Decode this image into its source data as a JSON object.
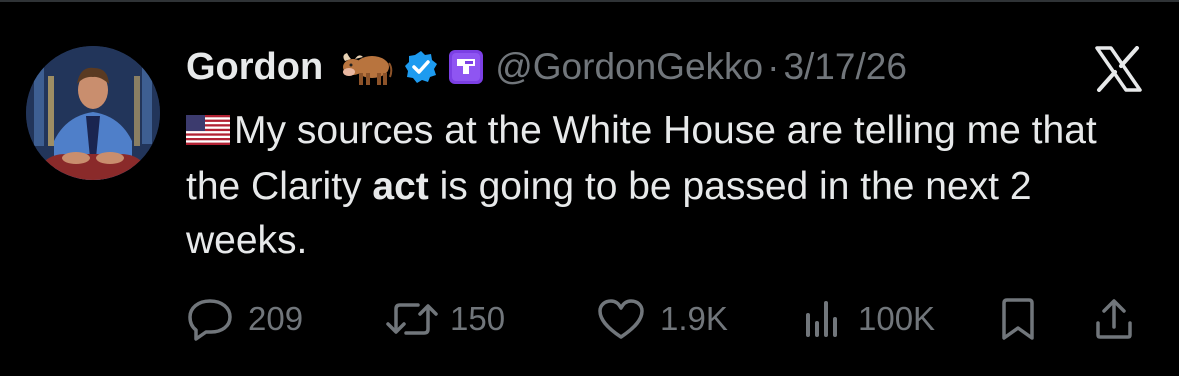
{
  "tweet": {
    "author_name": "Gordon",
    "name_emoji": "cow",
    "handle": "@GordonGekko",
    "separator": "·",
    "date": "3/17/26",
    "text_flag": "us-flag",
    "text_before": "My sources at the White House are telling me that the Clarity ",
    "text_bold": "act",
    "text_after": " is going to be passed in the next 2 weeks."
  },
  "actions": {
    "replies": "209",
    "reposts": "150",
    "likes": "1.9K",
    "views": "100K"
  },
  "colors": {
    "background": "#000000",
    "text": "#e7e9ea",
    "muted": "#71767b",
    "verified": "#1d9bf0"
  },
  "icons": [
    "cow-emoji-icon",
    "verified-badge-icon",
    "affiliate-badge-icon",
    "x-logo-icon",
    "us-flag-icon",
    "reply-icon",
    "repost-icon",
    "like-icon",
    "views-icon",
    "bookmark-icon",
    "share-icon"
  ]
}
